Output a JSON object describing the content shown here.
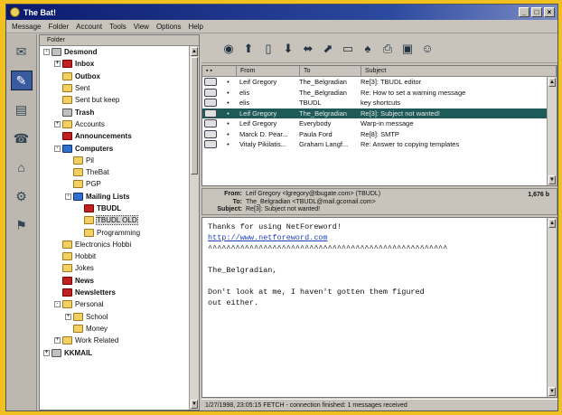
{
  "window": {
    "title": "The Bat!"
  },
  "menu": [
    "Message",
    "Folder",
    "Account",
    "Tools",
    "View",
    "Options",
    "Help"
  ],
  "tree": {
    "header": "Folder",
    "items": [
      {
        "label": "Desmond",
        "depth": 0,
        "icon": "grey",
        "bold": true,
        "expand": "-"
      },
      {
        "label": "Inbox",
        "depth": 1,
        "icon": "red",
        "bold": true,
        "expand": "+"
      },
      {
        "label": "Outbox",
        "depth": 1,
        "icon": "yellow",
        "bold": true,
        "expand": ""
      },
      {
        "label": "Sent",
        "depth": 1,
        "icon": "yellow",
        "bold": false,
        "expand": ""
      },
      {
        "label": "Sent but keep",
        "depth": 1,
        "icon": "yellow",
        "bold": false,
        "expand": ""
      },
      {
        "label": "Trash",
        "depth": 1,
        "icon": "grey",
        "bold": true,
        "expand": ""
      },
      {
        "label": "Accounts",
        "depth": 1,
        "icon": "yellow",
        "bold": false,
        "expand": "+"
      },
      {
        "label": "Announcements",
        "depth": 1,
        "icon": "red",
        "bold": true,
        "expand": ""
      },
      {
        "label": "Computers",
        "depth": 1,
        "icon": "blue",
        "bold": true,
        "expand": "-"
      },
      {
        "label": "Pil",
        "depth": 2,
        "icon": "yellow",
        "bold": false,
        "expand": ""
      },
      {
        "label": "TheBat",
        "depth": 2,
        "icon": "yellow",
        "bold": false,
        "expand": ""
      },
      {
        "label": "PGP",
        "depth": 2,
        "icon": "yellow",
        "bold": false,
        "expand": ""
      },
      {
        "label": "Mailing Lists",
        "depth": 2,
        "icon": "blue",
        "bold": true,
        "expand": "-"
      },
      {
        "label": "TBUDL",
        "depth": 3,
        "icon": "red",
        "bold": true,
        "expand": ""
      },
      {
        "label": "TBUDL OLD",
        "depth": 3,
        "icon": "yellow",
        "bold": false,
        "expand": "",
        "selected": true
      },
      {
        "label": "Programming",
        "depth": 3,
        "icon": "yellow",
        "bold": false,
        "expand": ""
      },
      {
        "label": "Electronics Hobbi",
        "depth": 1,
        "icon": "yellow",
        "bold": false,
        "expand": ""
      },
      {
        "label": "Hobbit",
        "depth": 1,
        "icon": "yellow",
        "bold": false,
        "expand": ""
      },
      {
        "label": "Jokes",
        "depth": 1,
        "icon": "yellow",
        "bold": false,
        "expand": ""
      },
      {
        "label": "News",
        "depth": 1,
        "icon": "red",
        "bold": true,
        "expand": ""
      },
      {
        "label": "Newsletters",
        "depth": 1,
        "icon": "red",
        "bold": true,
        "expand": ""
      },
      {
        "label": "Personal",
        "depth": 1,
        "icon": "yellow",
        "bold": false,
        "expand": "-"
      },
      {
        "label": "School",
        "depth": 2,
        "icon": "yellow",
        "bold": false,
        "expand": "+"
      },
      {
        "label": "Money",
        "depth": 2,
        "icon": "yellow",
        "bold": false,
        "expand": ""
      },
      {
        "label": "Work Related",
        "depth": 1,
        "icon": "yellow",
        "bold": false,
        "expand": "+"
      },
      {
        "label": "KKMAIL",
        "depth": 0,
        "icon": "grey",
        "bold": true,
        "expand": "+"
      }
    ]
  },
  "messages": {
    "columns": [
      "From",
      "To",
      "Subject"
    ],
    "rows": [
      {
        "from": "Leif Gregory",
        "to": "The_Belgradian",
        "subject": "Re[3]: TBUDL editor",
        "selected": false
      },
      {
        "from": "elis",
        "to": "The_Belgradian",
        "subject": "Re: How to set a warning message",
        "selected": false
      },
      {
        "from": "elis",
        "to": "TBUDL",
        "subject": "key shortcuts",
        "selected": false
      },
      {
        "from": "Leif Gregory",
        "to": "The_Belgradian",
        "subject": "Re[3]: Subject not wanted!",
        "selected": true
      },
      {
        "from": "Leif Gregory",
        "to": "Everybody",
        "subject": "Warp-in message",
        "selected": false
      },
      {
        "from": "Marck D. Pear...",
        "to": "Paula Ford",
        "subject": "Re[8]: SMTP",
        "selected": false
      },
      {
        "from": "Vitaly Pikilatis...",
        "to": "Graham Langf...",
        "subject": "Re: Answer to copying templates",
        "selected": false
      }
    ]
  },
  "header_info": {
    "from_label": "From:",
    "from": "Leif Gregory <lgregory@tbugate.com> (TBUDL)",
    "to_label": "To:",
    "to": "The_Belgradian <TBUDL@mail.gcomail.com>",
    "subject_label": "Subject:",
    "subject": "Re[3]: Subject not wanted!",
    "size": "1,676 b"
  },
  "body_lines": [
    "Thanks for using NetForeword!",
    "http://www.netforeword.com",
    "^^^^^^^^^^^^^^^^^^^^^^^^^^^^^^^^^^^^^^^^^^^^^^^^^^^^",
    "",
    "The_Belgradian,",
    "",
    "Don't look at me, I haven't gotten them figured",
    "out either."
  ],
  "status": "1/27/1998, 23:05:15 FETCH - connection finished: 1 messages received"
}
